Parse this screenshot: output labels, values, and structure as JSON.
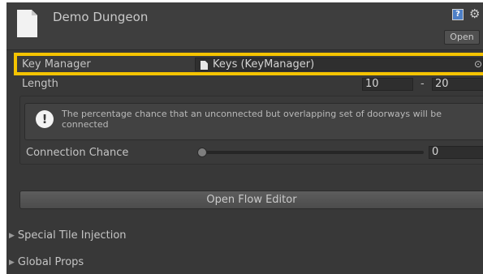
{
  "header": {
    "title": "Demo Dungeon",
    "open_label": "Open",
    "help_icon": "?",
    "gear_icon": "⚙"
  },
  "key_manager": {
    "label": "Key Manager",
    "value": "Keys (KeyManager)",
    "picker_icon": "⊙",
    "highlight_color": "#f5c400"
  },
  "length": {
    "label": "Length",
    "min": "10",
    "separator": "-",
    "max": "20"
  },
  "help": {
    "icon": "!",
    "text": "The percentage chance that an unconnected but overlapping set of doorways will be connected"
  },
  "connection_chance": {
    "label": "Connection Chance",
    "value": "0",
    "slider_fraction": 0
  },
  "flow_button": {
    "label": "Open Flow Editor"
  },
  "foldouts": [
    {
      "label": "Special Tile Injection",
      "arrow": "▶"
    },
    {
      "label": "Global Props",
      "arrow": "▶"
    }
  ]
}
